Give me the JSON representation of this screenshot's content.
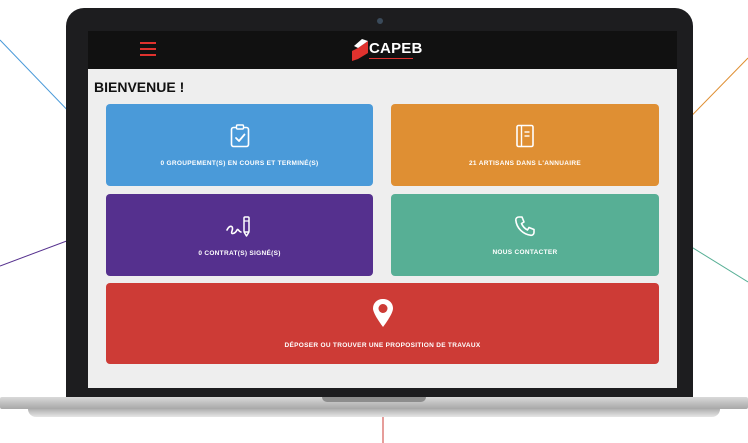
{
  "header": {
    "menu_icon": "hamburger-menu-icon",
    "logo_text": "CAPEB",
    "logo_icon": "capeb-logo-icon"
  },
  "page_title": "BIENVENUE !",
  "tiles": {
    "groupements": {
      "label": "0 GROUPEMENT(S) EN COURS ET TERMINÉ(S)",
      "icon": "clipboard-check-icon",
      "color": "#4a9ad9"
    },
    "annuaire": {
      "label": "21 ARTISANS DANS L'ANNUAIRE",
      "icon": "directory-book-icon",
      "color": "#df8f33"
    },
    "contrats": {
      "label": "0 CONTRAT(S) SIGNÉ(S)",
      "icon": "signature-pen-icon",
      "color": "#55308e"
    },
    "contact": {
      "label": "NOUS CONTACTER",
      "icon": "phone-icon",
      "color": "#57af95"
    },
    "travaux": {
      "label": "DÉPOSER OU TROUVER UNE PROPOSITION DE TRAVAUX",
      "icon": "map-pin-icon",
      "color": "#cd3b36"
    }
  },
  "colors": {
    "accent_red": "#e0322e",
    "header_bg": "#111111",
    "screen_bg": "#eeeeee"
  }
}
